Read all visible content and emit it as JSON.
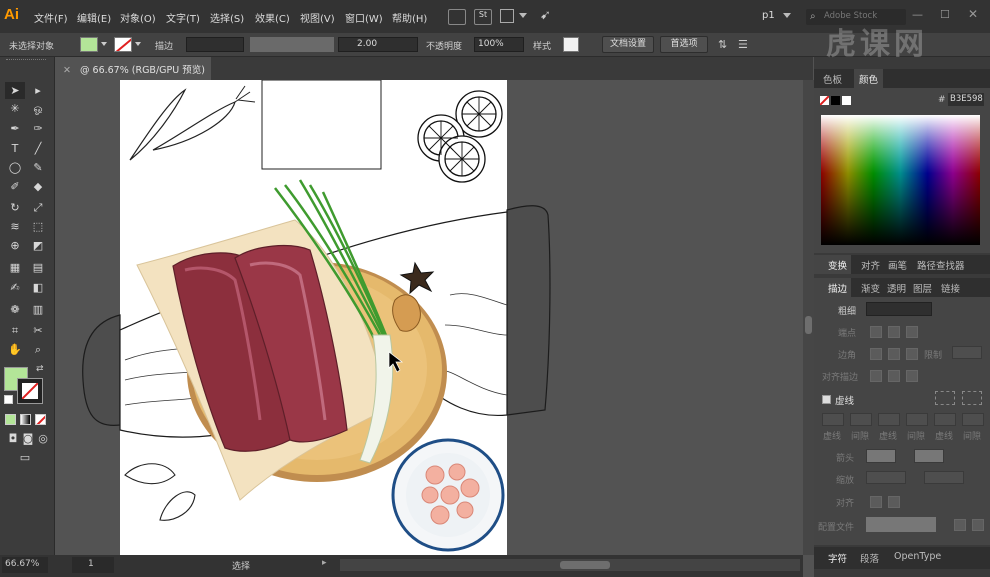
{
  "app": {
    "logo": "Ai",
    "workspace": "p1",
    "search_placeholder": "Adobe Stock"
  },
  "menu": [
    "文件(F)",
    "编辑(E)",
    "对象(O)",
    "文字(T)",
    "选择(S)",
    "效果(C)",
    "视图(V)",
    "窗口(W)",
    "帮助(H)"
  ],
  "control": {
    "no_selection": "未选择对象",
    "stroke_label": "描边",
    "brush_value": "2.00",
    "opacity_label": "不透明度",
    "opacity_value": "100%",
    "style_label": "样式",
    "doc_setup": "文档设置",
    "preferences": "首选项"
  },
  "document": {
    "tab_title": "@ 66.67% (RGB/GPU 预览)"
  },
  "status": {
    "zoom": "66.67%",
    "page": "1",
    "tool": "选择",
    "scroll_arrow": "▸"
  },
  "panels": {
    "color_tabs": [
      "色板",
      "颜色"
    ],
    "hex_value": "B3E598",
    "transform_tabs": [
      "变换",
      "对齐",
      "画笔",
      "路径查找器"
    ],
    "stroke_tabs": [
      "描边",
      "渐变",
      "透明",
      "图层",
      "链接"
    ],
    "weight_label": "粗细",
    "stroke_dim": [
      "端点",
      "边角",
      "对齐描边"
    ],
    "dashed_label": "虚线",
    "dash_labels": [
      "虚线",
      "间隙",
      "虚线",
      "间隙",
      "虚线",
      "间隙"
    ],
    "arrow_labels": [
      "箭头",
      "缩放",
      "对齐"
    ],
    "profile_label": "配置文件",
    "bottom_tabs": [
      "字符",
      "段落",
      "OpenType"
    ]
  },
  "watermark": "虎课网",
  "colors": {
    "fill": "#B3E598",
    "accent": "#ff9a00"
  }
}
